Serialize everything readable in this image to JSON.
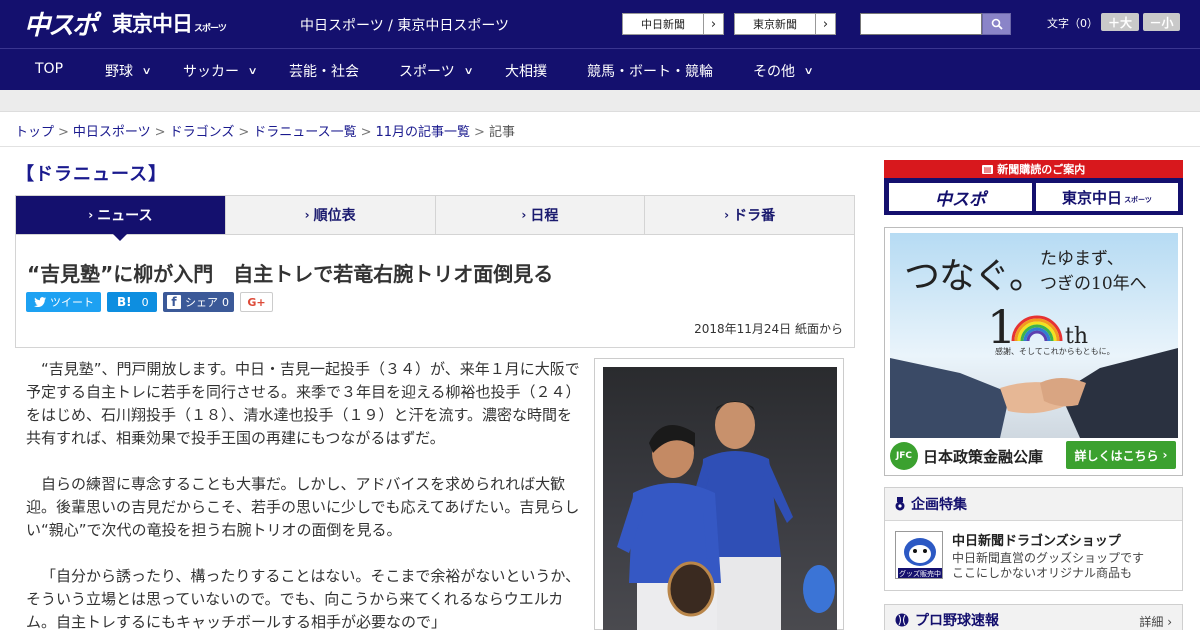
{
  "header": {
    "logo_chuspo": "中スポ",
    "logo_tokyo": "東京中日",
    "logo_tokyo_small": "スポーツ",
    "site_names": "中日スポーツ / 東京中日スポーツ",
    "ext_link_1": "中日新聞",
    "ext_link_2": "東京新聞",
    "search_placeholder": "",
    "fontsize_label": "文字（0）",
    "font_bigger": "＋大",
    "font_smaller": "－小"
  },
  "nav": {
    "items": [
      {
        "label": "TOP"
      },
      {
        "label": "野球"
      },
      {
        "label": "サッカー"
      },
      {
        "label": "芸能・社会"
      },
      {
        "label": "スポーツ"
      },
      {
        "label": "大相撲"
      },
      {
        "label": "競馬・ボート・競輪"
      },
      {
        "label": "その他"
      }
    ]
  },
  "breadcrumb": {
    "items": [
      "トップ",
      "中日スポーツ",
      "ドラゴンズ",
      "ドラニュース一覧",
      "11月の記事一覧"
    ],
    "current": "記事",
    "separator": ">"
  },
  "section": {
    "title": "【ドラニュース】"
  },
  "tabs": [
    "ニュース",
    "順位表",
    "日程",
    "ドラ番"
  ],
  "article": {
    "headline": "“吉見塾”に柳が入門　自主トレで若竜右腕トリオ面倒見る",
    "share": {
      "tweet": "ツイート",
      "hatena": "B!",
      "hatena_count": "0",
      "facebook": "シェア",
      "facebook_count": "0",
      "gplus": "G+"
    },
    "date": "2018年11月24日 紙面から",
    "paragraphs": [
      "“吉見塾”、門戸開放します。中日・吉見一起投手（３４）が、来年１月に大阪で予定する自主トレに若手を同行させる。来季で３年目を迎える柳裕也投手（２４）をはじめ、石川翔投手（１８）、清水達也投手（１９）と汗を流す。濃密な時間を共有すれば、相乗効果で投手王国の再建にもつながるはずだ。",
      "自らの練習に専念することも大事だ。しかし、アドバイスを求められれば大歓迎。後輩思いの吉見だからこそ、若手の思いに少しでも応えてあげたい。吉見らしい“親心”で次代の竜投を担う右腕トリオの面倒を見る。",
      "「自分から誘ったり、構ったりすることはない。そこまで余裕がないというか、そういう立場とは思っていないので。でも、向こうから来てくれるならウエルカム。自主トレするにもキャッチボールする相手が必要なので」"
    ]
  },
  "sidebar": {
    "subscribe": {
      "head": "新聞購読のご案内",
      "logo1": "中スポ",
      "logo2": "東京中日",
      "logo2_small": "スポーツ"
    },
    "ad": {
      "main": "つなぐ。",
      "sub1": "たゆまず、",
      "sub2": "つぎの10年へ",
      "ten_a": "1",
      "ten_b": "th",
      "motto": "感謝、そしてこれからもともに。",
      "org_logo": "JFC",
      "org": "日本政策金融公庫",
      "cta": "詳しくはこちら"
    },
    "feature": {
      "head": "企画特集",
      "thumb_badge": "グッズ販売中",
      "title": "中日新聞ドラゴンズショップ",
      "desc1": "中日新聞直営のグッズショップです",
      "desc2": "ここにしかないオリジナル商品も"
    },
    "scores": {
      "head": "プロ野球速報",
      "more": "詳細 ›"
    }
  }
}
